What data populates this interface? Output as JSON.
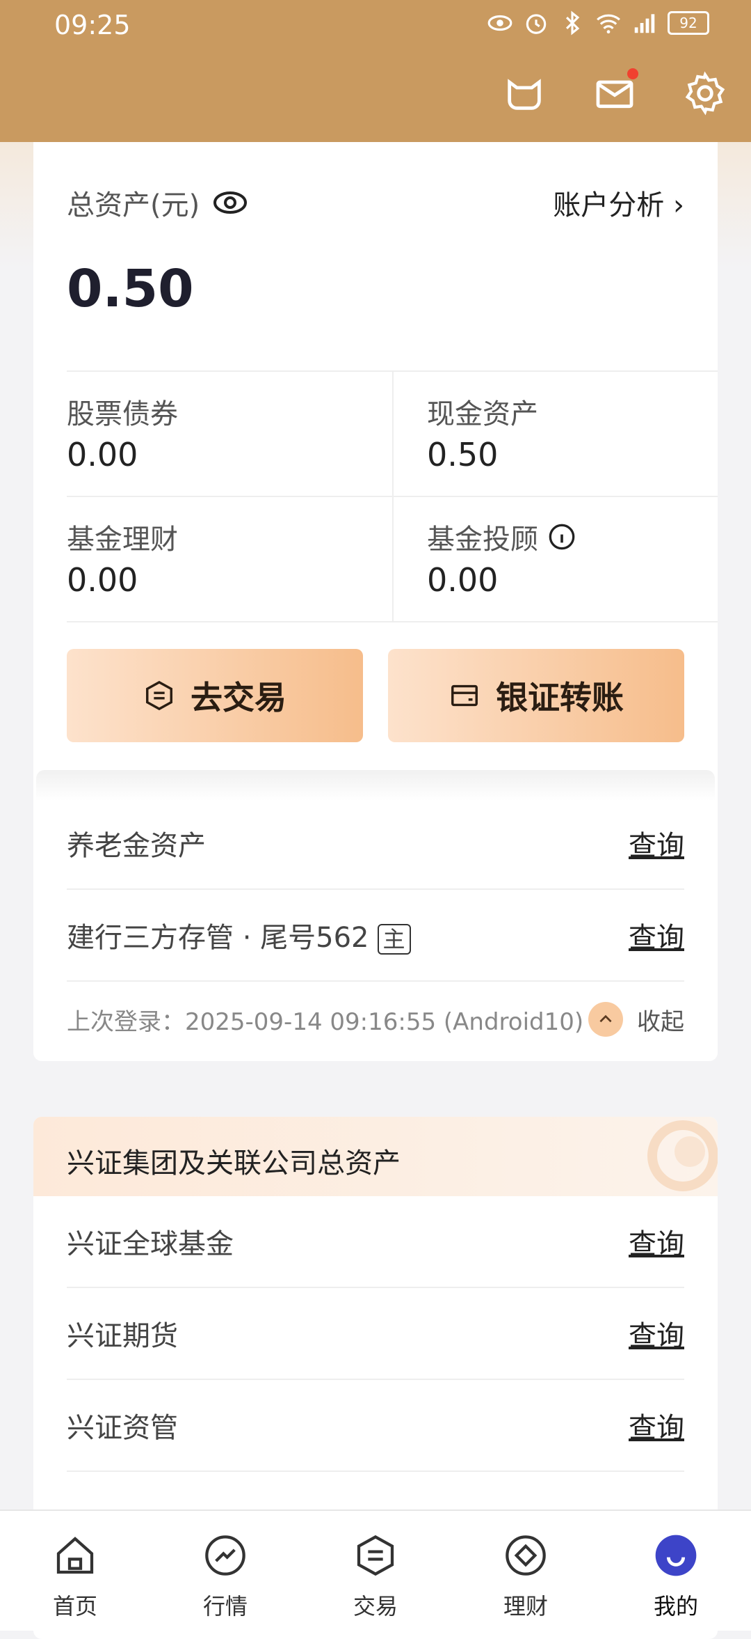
{
  "status": {
    "time": "09:25",
    "battery": "92"
  },
  "account": {
    "total_label": "总资产(元)",
    "analysis_label": "账户分析 ›",
    "total_value": "0.50",
    "cells": [
      {
        "label": "股票债券",
        "value": "0.00"
      },
      {
        "label": "现金资产",
        "value": "0.50"
      },
      {
        "label": "基金理财",
        "value": "0.00"
      },
      {
        "label": "基金投顾",
        "value": "0.00"
      }
    ],
    "trade_button": "去交易",
    "bank_button": "银证转账",
    "rows": [
      {
        "label": "养老金资产",
        "action": "查询"
      },
      {
        "label": "建行三方存管 · 尾号562",
        "tag": "主",
        "action": "查询"
      }
    ],
    "last_login": "上次登录：2025-09-14 09:16:55 (Android10)",
    "collapse_label": "收起"
  },
  "group": {
    "title": "兴证集团及关联公司总资产",
    "rows": [
      {
        "label": "兴证全球基金",
        "action": "查询"
      },
      {
        "label": "兴证期货",
        "action": "查询"
      },
      {
        "label": "兴证资管",
        "action": "查询"
      }
    ]
  },
  "nav": [
    {
      "label": "首页",
      "icon": "home-icon"
    },
    {
      "label": "行情",
      "icon": "market-icon"
    },
    {
      "label": "交易",
      "icon": "trade-icon"
    },
    {
      "label": "理财",
      "icon": "wealth-icon"
    },
    {
      "label": "我的",
      "icon": "profile-icon"
    }
  ],
  "colors": {
    "header": "#c99a60",
    "button_start": "#fde2cc",
    "button_end": "#f6bd8b",
    "accent_blue": "#3d44c8"
  }
}
